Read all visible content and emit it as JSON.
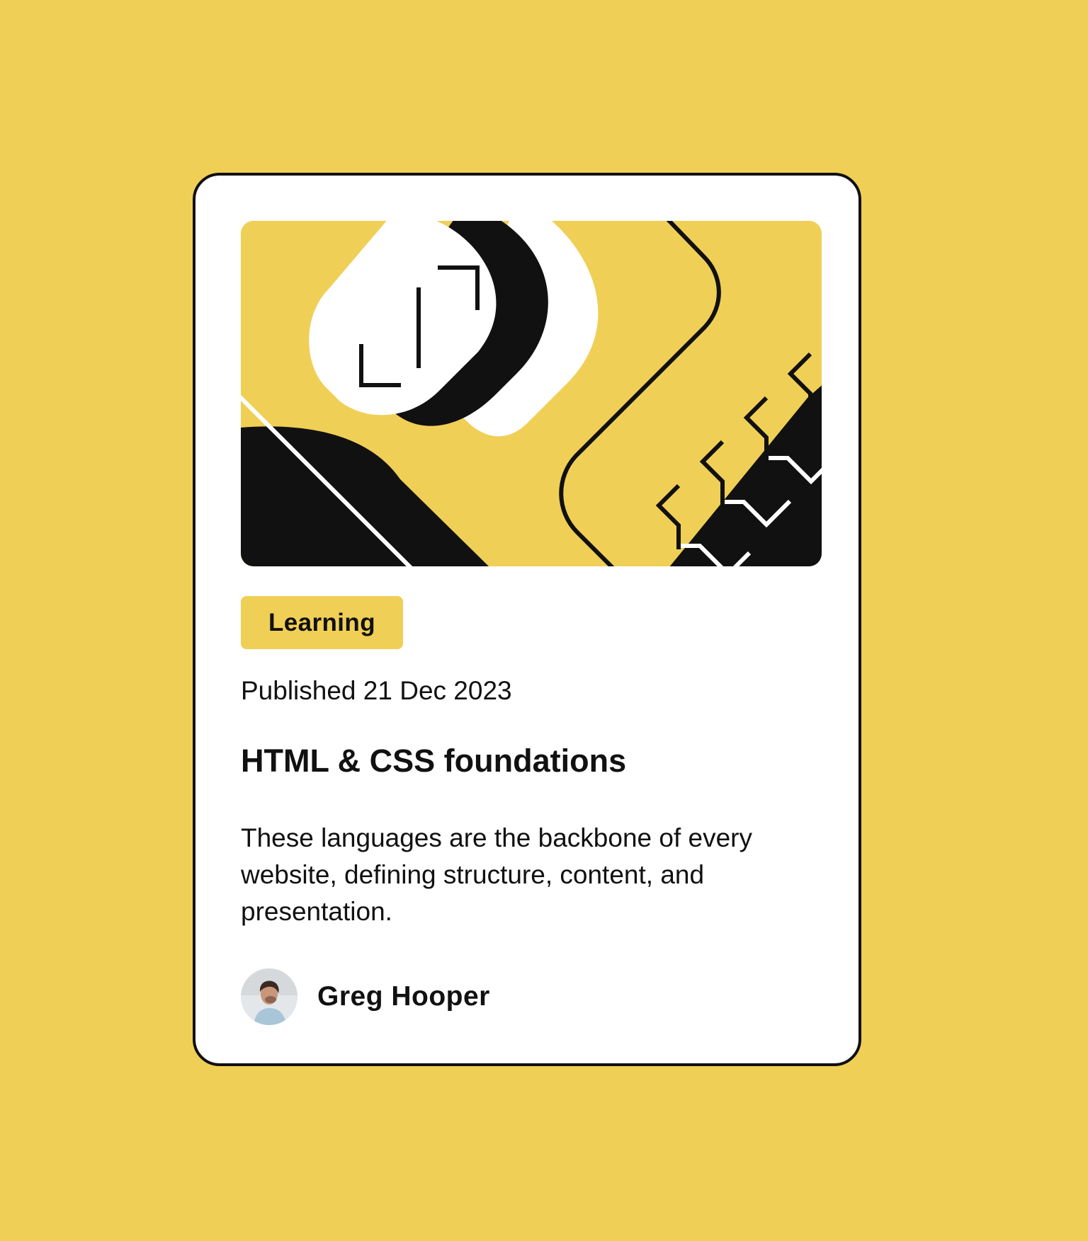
{
  "card": {
    "tag": "Learning",
    "published": "Published 21 Dec 2023",
    "title": "HTML & CSS foundations",
    "description": "These languages are the backbone of every website, defining structure, content, and presentation.",
    "author": {
      "name": "Greg Hooper",
      "avatar_icon": "author-avatar"
    },
    "hero_icon": "illustration-article"
  },
  "colors": {
    "background": "#f0cf56",
    "card": "#ffffff",
    "ink": "#111111"
  }
}
